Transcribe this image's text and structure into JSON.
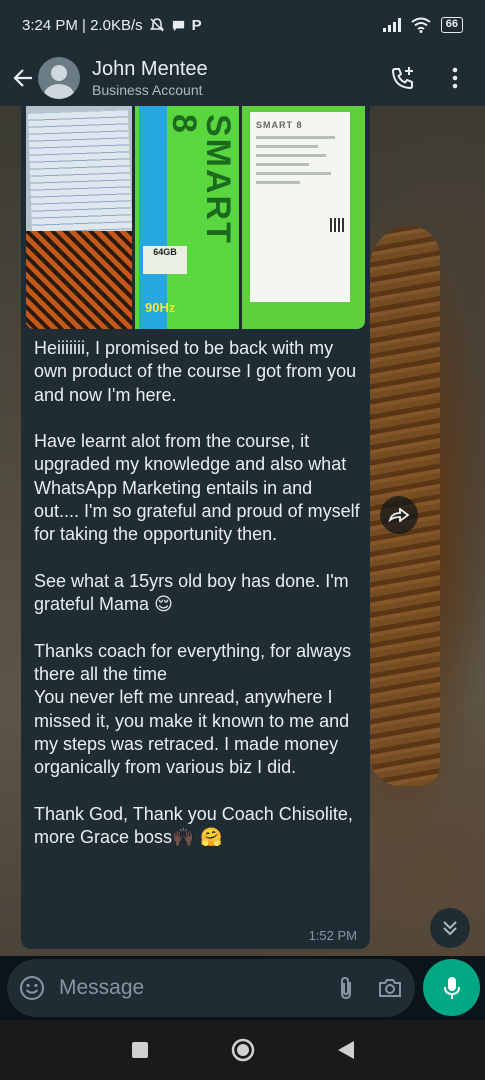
{
  "status_bar": {
    "time_speed": "3:24 PM | 2.0KB/s",
    "battery": "66",
    "icons": [
      "mute-icon",
      "chat-bubble-icon",
      "p-icon",
      "signal-icon",
      "wifi-icon",
      "battery-icon"
    ]
  },
  "header": {
    "contact_name": "John Mentee",
    "contact_subtitle": "Business Account",
    "icons": [
      "back-arrow-icon",
      "avatar",
      "add-call-icon",
      "more-vert-icon"
    ]
  },
  "photos": {
    "box_brand": "SMART 8",
    "box_storage": "64GB",
    "box_refresh": "90Hz",
    "sheet_brand": "SMART 8"
  },
  "message": {
    "text": "Heiiiiiii, I promised to be back with my own product of the course I got from you and now I'm here.\n\nHave learnt alot from the course, it upgraded my knowledge and also what WhatsApp Marketing entails in and out.... I'm so grateful and proud of myself for taking the opportunity then.\n\nSee what a 15yrs old boy has done. I'm grateful Mama ",
    "emoji_relieved": "😌",
    "text2": "\n\nThanks coach for everything, for always there all the time\nYou never left me unread, anywhere I missed it, you make it known to me and my steps was retraced. I made money organically from various biz I did.\n\nThank God, Thank you Coach Chisolite, more Grace boss",
    "emoji_end": "🙌🏿 🤗",
    "time": "1:52 PM"
  },
  "composer": {
    "placeholder": "Message"
  },
  "colors": {
    "bar_bg": "#1f2c34",
    "bubble_bg": "#1f2c34",
    "accent": "#00a884",
    "text_primary": "#e9edef",
    "text_secondary": "#8696a0"
  }
}
